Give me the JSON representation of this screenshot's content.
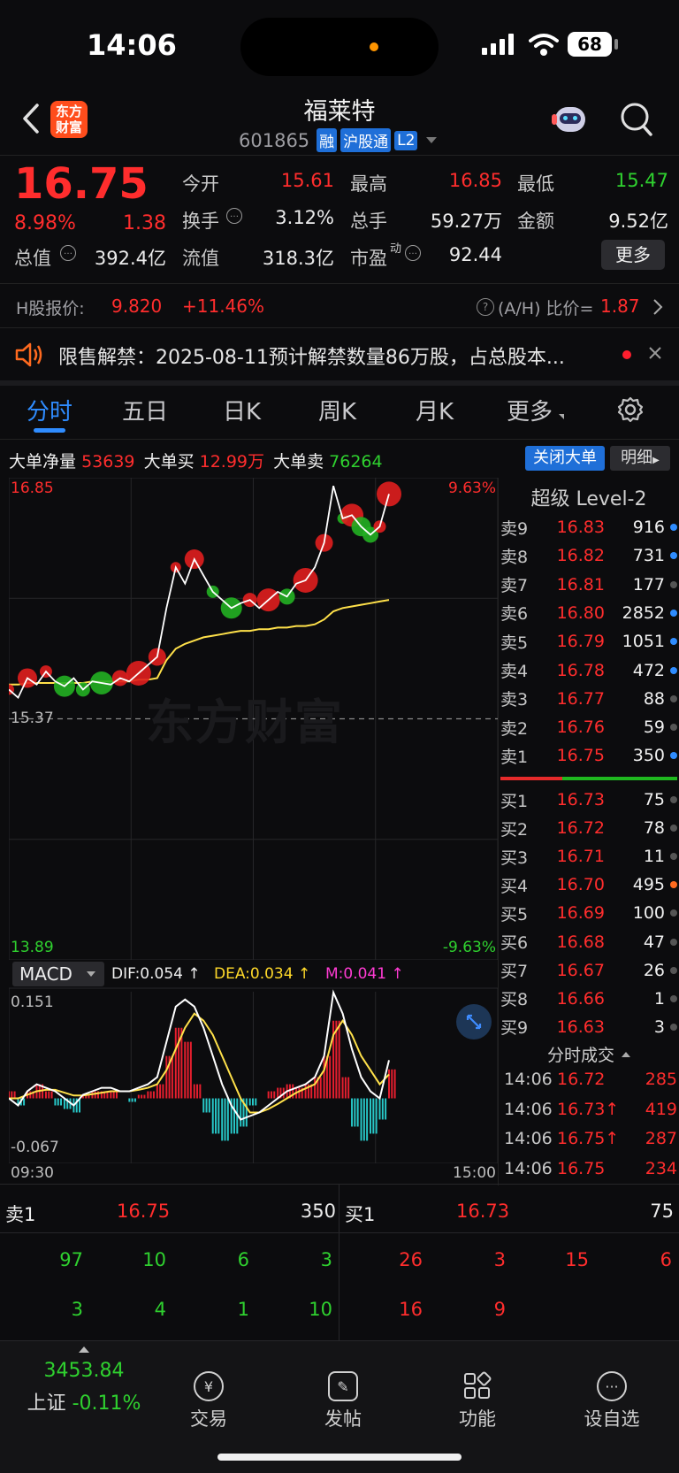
{
  "status_bar": {
    "time": "14:06",
    "battery": "68"
  },
  "header": {
    "logo_text": "东方\n财富",
    "stock_name": "福莱特",
    "stock_code": "601865",
    "badges": [
      "融",
      "沪股通",
      "L2"
    ]
  },
  "quote": {
    "price": "16.75",
    "change_pct": "8.98%",
    "change_abs": "1.38",
    "open_label": "今开",
    "open": "15.61",
    "high_label": "最高",
    "high": "16.85",
    "low_label": "最低",
    "low": "15.47",
    "turnover_label": "换手",
    "turnover": "3.12%",
    "volume_label": "总手",
    "volume": "59.27万",
    "amount_label": "金额",
    "amount": "9.52亿",
    "mktcap_label": "总值",
    "mktcap": "392.4亿",
    "float_label": "流值",
    "float_cap": "318.3亿",
    "pe_label": "市盈",
    "pe_sup": "动",
    "pe": "92.44",
    "more_button": "更多"
  },
  "hshare": {
    "label": "H股报价:",
    "price": "9.820",
    "change": "+11.46%",
    "ah_label": "(A/H) 比价=",
    "ah_value": "1.87"
  },
  "notice": {
    "text": "限售解禁：2025-08-11预计解禁数量86万股，占总股本..."
  },
  "tabs": [
    {
      "label": "分时"
    },
    {
      "label": "五日"
    },
    {
      "label": "日K"
    },
    {
      "label": "周K"
    },
    {
      "label": "月K"
    },
    {
      "label": "更多"
    }
  ],
  "bigorder": {
    "net_label": "大单净量",
    "net": "53639",
    "buy_label": "大单买",
    "buy": "12.99万",
    "sell_label": "大单卖",
    "sell": "76264",
    "close_button": "关闭大单",
    "detail_button": "明细"
  },
  "chart_data": {
    "type": "line",
    "y_top": "16.85",
    "y_bottom": "13.89",
    "y_ref": "15.37",
    "pct_top": "9.63%",
    "pct_bottom": "-9.63%",
    "x_start": "09:30",
    "x_end": "15:00",
    "ylim": [
      13.89,
      16.85
    ],
    "series": [
      {
        "values": [
          15.55,
          15.5,
          15.62,
          15.58,
          15.66,
          15.6,
          15.57,
          15.62,
          15.55,
          15.6,
          15.59,
          15.58,
          15.62,
          15.6,
          15.65,
          15.7,
          15.75,
          16.05,
          16.3,
          16.2,
          16.35,
          16.25,
          16.15,
          16.1,
          16.05,
          16.08,
          16.1,
          16.05,
          16.1,
          16.15,
          16.12,
          16.2,
          16.22,
          16.3,
          16.45,
          16.8,
          16.6,
          16.62,
          16.55,
          16.5,
          16.55,
          16.75
        ]
      },
      {
        "values": [
          15.58,
          15.58,
          15.59,
          15.59,
          15.59,
          15.59,
          15.59,
          15.59,
          15.59,
          15.6,
          15.6,
          15.6,
          15.6,
          15.6,
          15.61,
          15.61,
          15.62,
          15.73,
          15.8,
          15.83,
          15.85,
          15.87,
          15.88,
          15.89,
          15.9,
          15.91,
          15.91,
          15.92,
          15.92,
          15.93,
          15.93,
          15.94,
          15.94,
          15.95,
          15.98,
          16.03,
          16.05,
          16.06,
          16.07,
          16.08,
          16.09,
          16.1
        ]
      }
    ]
  },
  "macd": {
    "label": "MACD",
    "dif_label": "DIF:0.054 ↑",
    "dea_label": "DEA:0.034 ↑",
    "m_label": "M:0.041 ↑",
    "y_top": "0.151",
    "y_bottom": "-0.067",
    "ylim": [
      -0.067,
      0.151
    ],
    "dif": [
      0.0,
      -0.01,
      0.01,
      0.02,
      0.015,
      0.01,
      0.0,
      -0.01,
      0.005,
      0.01,
      0.015,
      0.015,
      0.01,
      0.01,
      0.015,
      0.02,
      0.03,
      0.08,
      0.13,
      0.14,
      0.13,
      0.1,
      0.06,
      0.02,
      -0.01,
      -0.03,
      -0.025,
      -0.02,
      -0.01,
      0.0,
      0.01,
      0.015,
      0.02,
      0.03,
      0.06,
      0.15,
      0.12,
      0.07,
      0.03,
      0.01,
      0.0,
      0.054
    ],
    "dea": [
      0.0,
      0.0,
      0.005,
      0.01,
      0.012,
      0.012,
      0.008,
      0.004,
      0.004,
      0.006,
      0.008,
      0.01,
      0.01,
      0.01,
      0.012,
      0.015,
      0.02,
      0.04,
      0.07,
      0.1,
      0.12,
      0.11,
      0.09,
      0.06,
      0.03,
      0.0,
      -0.02,
      -0.02,
      -0.015,
      -0.008,
      0.0,
      0.008,
      0.014,
      0.02,
      0.04,
      0.09,
      0.11,
      0.09,
      0.06,
      0.04,
      0.02,
      0.034
    ],
    "m": [
      0.01,
      -0.01,
      0.01,
      0.02,
      0.01,
      -0.01,
      -0.015,
      -0.02,
      0.005,
      0.01,
      0.01,
      0.01,
      0.0,
      -0.005,
      0.005,
      0.01,
      0.02,
      0.06,
      0.1,
      0.08,
      0.02,
      -0.02,
      -0.05,
      -0.06,
      -0.05,
      -0.04,
      -0.01,
      0.0,
      0.01,
      0.015,
      0.02,
      0.015,
      0.02,
      0.03,
      0.06,
      0.11,
      0.03,
      -0.04,
      -0.06,
      -0.05,
      -0.03,
      0.041
    ]
  },
  "orderbook": {
    "title": "超级 Level-2",
    "asks": [
      {
        "label": "卖9",
        "price": "16.83",
        "vol": "916",
        "dot": "#2f8cff"
      },
      {
        "label": "卖8",
        "price": "16.82",
        "vol": "731",
        "dot": "#2f8cff"
      },
      {
        "label": "卖7",
        "price": "16.81",
        "vol": "177",
        "dot": "#555555"
      },
      {
        "label": "卖6",
        "price": "16.80",
        "vol": "2852",
        "dot": "#2f8cff"
      },
      {
        "label": "卖5",
        "price": "16.79",
        "vol": "1051",
        "dot": "#2f8cff"
      },
      {
        "label": "卖4",
        "price": "16.78",
        "vol": "472",
        "dot": "#2f8cff"
      },
      {
        "label": "卖3",
        "price": "16.77",
        "vol": "88",
        "dot": "#555555"
      },
      {
        "label": "卖2",
        "price": "16.76",
        "vol": "59",
        "dot": "#555555"
      },
      {
        "label": "卖1",
        "price": "16.75",
        "vol": "350",
        "dot": "#2f8cff"
      }
    ],
    "bids": [
      {
        "label": "买1",
        "price": "16.73",
        "vol": "75",
        "dot": "#555555"
      },
      {
        "label": "买2",
        "price": "16.72",
        "vol": "78",
        "dot": "#555555"
      },
      {
        "label": "买3",
        "price": "16.71",
        "vol": "11",
        "dot": "#555555"
      },
      {
        "label": "买4",
        "price": "16.70",
        "vol": "495",
        "dot": "#ff6a1f"
      },
      {
        "label": "买5",
        "price": "16.69",
        "vol": "100",
        "dot": "#555555"
      },
      {
        "label": "买6",
        "price": "16.68",
        "vol": "47",
        "dot": "#555555"
      },
      {
        "label": "买7",
        "price": "16.67",
        "vol": "26",
        "dot": "#555555"
      },
      {
        "label": "买8",
        "price": "16.66",
        "vol": "1",
        "dot": "#555555"
      },
      {
        "label": "买9",
        "price": "16.63",
        "vol": "3",
        "dot": "#555555"
      }
    ],
    "ticks_title": "分时成交",
    "ticks": [
      {
        "time": "14:06",
        "price": "16.72",
        "vol": "285"
      },
      {
        "time": "14:06",
        "price": "16.73↑",
        "vol": "419"
      },
      {
        "time": "14:06",
        "price": "16.75↑",
        "vol": "287"
      },
      {
        "time": "14:06",
        "price": "16.75",
        "vol": "234"
      }
    ]
  },
  "queue": {
    "ask_label": "卖1",
    "ask_price": "16.75",
    "ask_vol": "350",
    "bid_label": "买1",
    "bid_price": "16.73",
    "bid_vol": "75",
    "ask_queue": [
      "97",
      "10",
      "6",
      "3",
      "3",
      "4",
      "1",
      "10"
    ],
    "bid_queue": [
      "26",
      "3",
      "15",
      "6",
      "16",
      "9"
    ]
  },
  "bottom_nav": {
    "index_value": "3453.84",
    "index_name": "上证",
    "index_change": "-0.11%",
    "items": [
      {
        "label": "交易"
      },
      {
        "label": "发帖"
      },
      {
        "label": "功能"
      },
      {
        "label": "设自选"
      }
    ]
  }
}
